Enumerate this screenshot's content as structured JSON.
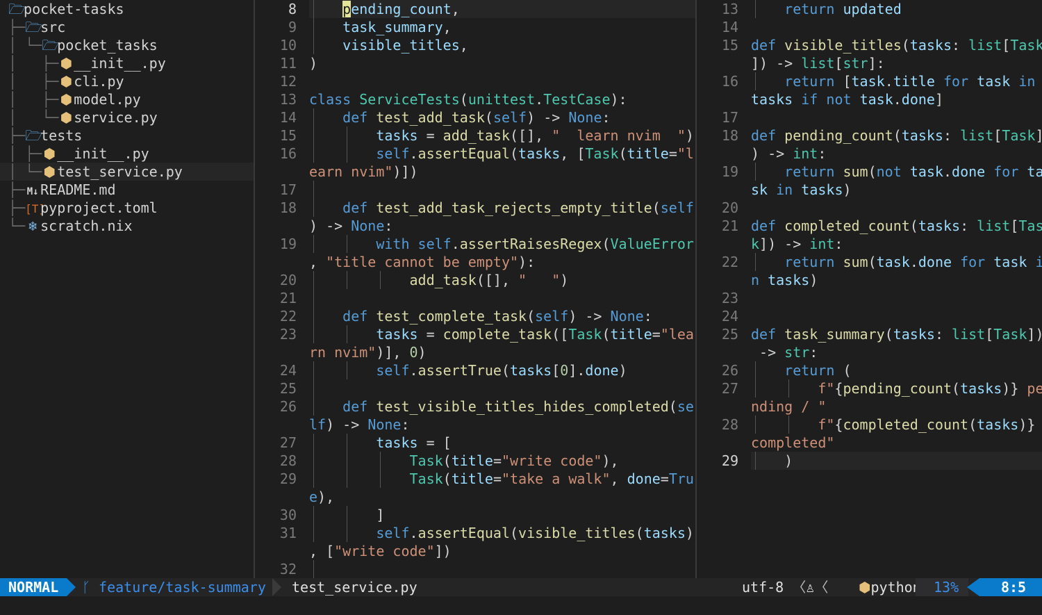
{
  "tree": {
    "items": [
      {
        "prefix": "",
        "icon": "folder-open-icon",
        "label": "pocket-tasks"
      },
      {
        "prefix": "├─",
        "icon": "folder-open-icon",
        "label": "src"
      },
      {
        "prefix": "│ └─",
        "icon": "folder-open-icon",
        "label": "pocket_tasks"
      },
      {
        "prefix": "│   ├─",
        "icon": "python-icon",
        "label": "__init__.py"
      },
      {
        "prefix": "│   ├─",
        "icon": "python-icon",
        "label": "cli.py"
      },
      {
        "prefix": "│   ├─",
        "icon": "python-icon",
        "label": "model.py"
      },
      {
        "prefix": "│   └─",
        "icon": "python-icon",
        "label": "service.py"
      },
      {
        "prefix": "├─",
        "icon": "folder-open-icon",
        "label": "tests"
      },
      {
        "prefix": "│ ├─",
        "icon": "python-icon",
        "label": "__init__.py"
      },
      {
        "prefix": "│ └─",
        "icon": "python-icon",
        "label": "test_service.py"
      },
      {
        "prefix": "├─",
        "icon": "markdown-icon",
        "label": "README.md"
      },
      {
        "prefix": "├─",
        "icon": "toml-icon",
        "label": "pyproject.toml"
      },
      {
        "prefix": "└─",
        "icon": "nix-icon",
        "label": "scratch.nix"
      }
    ],
    "selected_index": 9
  },
  "left_editor": {
    "file": "test_service.py",
    "line_numbers": [
      "8",
      "9",
      "10",
      "11",
      "12",
      "13",
      "14",
      "15",
      "16",
      "",
      "17",
      "18",
      "",
      "19",
      "",
      "20",
      "21",
      "22",
      "23",
      "",
      "24",
      "25",
      "26",
      "",
      "27",
      "28",
      "29",
      "",
      "30",
      "31",
      "",
      "32"
    ]
  },
  "right_editor": {
    "file": "service.py",
    "line_numbers": [
      "13",
      "14",
      "15",
      "",
      "16",
      "",
      "17",
      "18",
      "",
      "19",
      "",
      "20",
      "21",
      "",
      "22",
      "",
      "23",
      "24",
      "25",
      "",
      "26",
      "27",
      "",
      "28",
      "",
      "29"
    ]
  },
  "statusline": {
    "mode": "NORMAL",
    "branch_icon": "git-branch-icon",
    "branch": "feature/task-summary",
    "filename": "test_service.py",
    "encoding": "utf-8",
    "os_icon": "linux-icon",
    "language": "python",
    "percent": "13%",
    "position": "8:5"
  }
}
